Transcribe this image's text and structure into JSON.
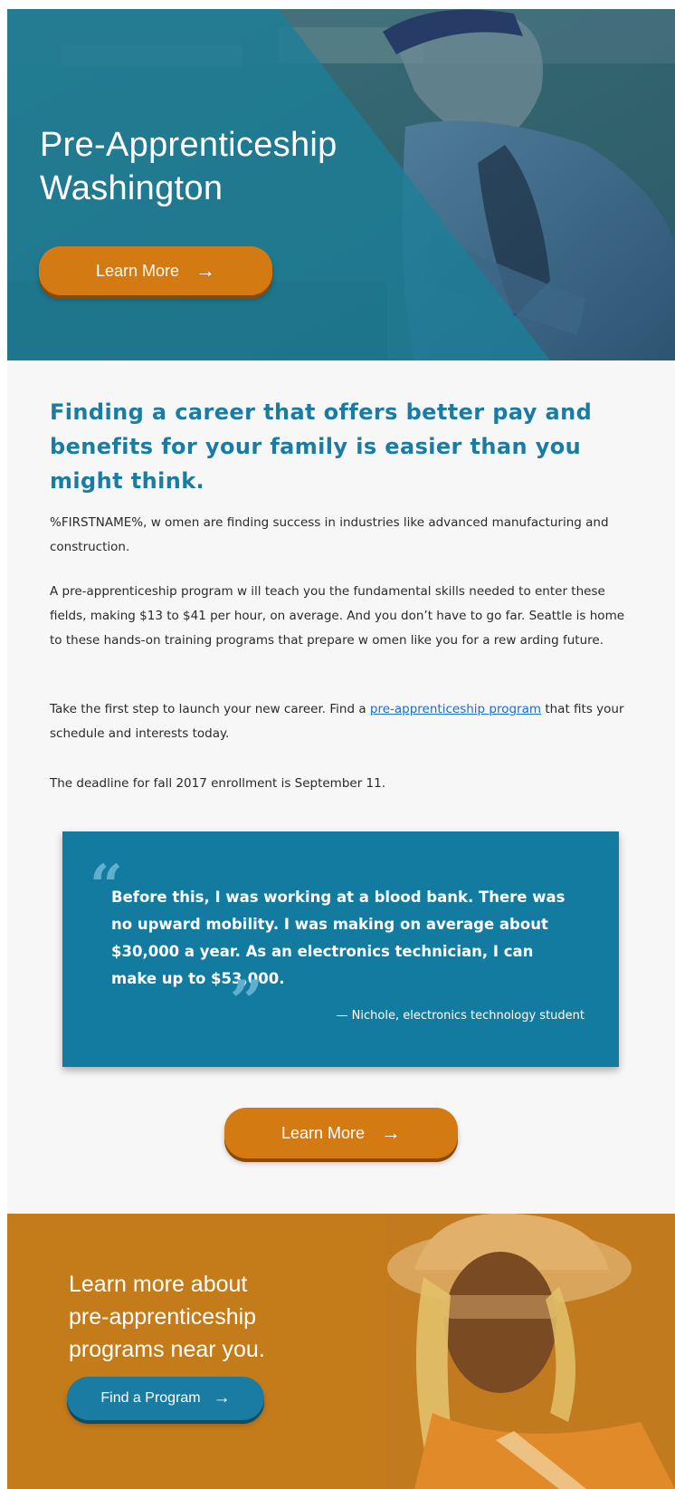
{
  "hero": {
    "title_line1": "Pre-Apprenticeship",
    "title_line2": "Washington",
    "button_label": "Learn More",
    "button_arrow": "→"
  },
  "main": {
    "headline": "Finding a career that offers better pay and benefits for your family is easier than you might think.",
    "paragraph1": "%FIRSTNAME%, w omen are finding success in industries like advanced manufacturing and construction.",
    "paragraph2": "A pre-apprenticeship program w ill teach you the fundamental skills needed to enter these fields, making $13 to $41 per hour, on average. And you don’t have to go far. Seattle is home to these hands-on training programs that prepare w omen like you for a rew arding future.",
    "paragraph3_before": "Take the first step to launch your new career. Find a ",
    "paragraph3_link": "pre-apprenticeship program",
    "paragraph3_after": " that fits your schedule and interests today.",
    "paragraph4": "The deadline for fall 2017 enrollment is September 11.",
    "quote": {
      "text": "Before this, I was working at a blood bank. There was no upward mobility. I was making on average about $30,000 a year. As an electronics technician, I can make up to $53,000.",
      "attribution": "— Nichole, electronics technology student"
    },
    "button_label": "Learn More",
    "button_arrow": "→"
  },
  "banner": {
    "line1": "Learn more about",
    "line2": "pre-apprenticeship",
    "line3": "programs near you.",
    "button_label": "Find a Program",
    "button_arrow": "→"
  },
  "colors": {
    "teal": "#1a7ca3",
    "orange": "#d47a12",
    "banner_orange": "#c47c1c"
  },
  "icons": {
    "arrow": "arrow-right-icon",
    "quote_open": "quote-open-icon",
    "quote_close": "quote-close-icon"
  }
}
